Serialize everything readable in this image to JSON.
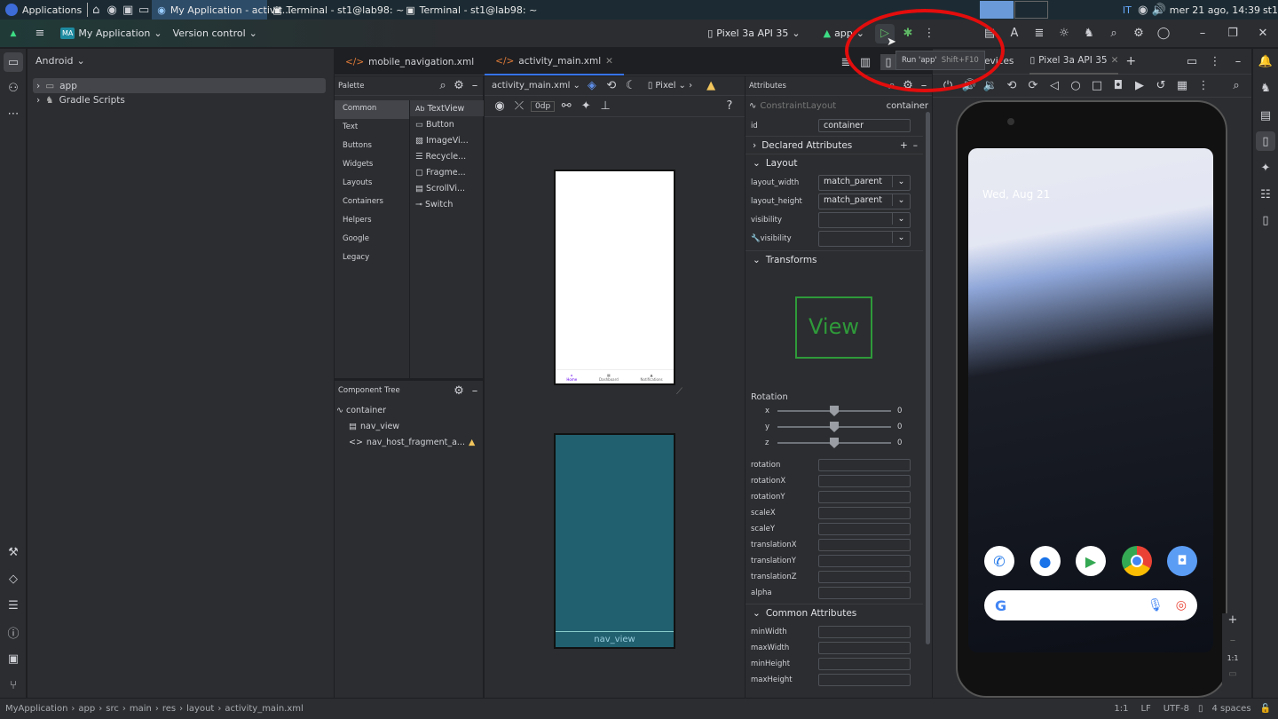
{
  "taskbar": {
    "apps_label": "Applications",
    "windows": [
      {
        "title": "My Application - activit...",
        "active": true
      },
      {
        "title": "Terminal - st1@lab98: ~"
      },
      {
        "title": "Terminal - st1@lab98: ~"
      }
    ],
    "keyboard": "IT",
    "clock": "mer 21 ago, 14:39",
    "user": "st1"
  },
  "toolbar": {
    "project_badge": "MA",
    "project": "My Application",
    "vcs": "Version control",
    "device": "Pixel 3a API 35",
    "run_config": "app",
    "tooltip": "Run 'app'",
    "tooltip_shortcut": "Shift+F10",
    "accent": "#3574f0"
  },
  "project": {
    "view": "Android",
    "items": [
      {
        "label": "app"
      },
      {
        "label": "Gradle Scripts"
      }
    ]
  },
  "editor": {
    "tabs": [
      {
        "label": "mobile_navigation.xml"
      },
      {
        "label": "activity_main.xml",
        "selected": true
      }
    ],
    "file_select": "activity_main.xml",
    "device_select": "Pixel",
    "margin": "0dp"
  },
  "palette": {
    "title": "Palette",
    "categories": [
      "Common",
      "Text",
      "Buttons",
      "Widgets",
      "Layouts",
      "Containers",
      "Helpers",
      "Google",
      "Legacy"
    ],
    "selected": "Common",
    "widgets": [
      "TextView",
      "Button",
      "ImageVi...",
      "Recycle...",
      "Fragme...",
      "ScrollVi...",
      "Switch"
    ]
  },
  "tree": {
    "title": "Component Tree",
    "items": [
      "container",
      "nav_view",
      "nav_host_fragment_a..."
    ]
  },
  "preview": {
    "nav": [
      "Home",
      "Dashboard",
      "Notifications"
    ],
    "blueprint_label": "nav_view"
  },
  "attributes": {
    "title": "Attributes",
    "class": "ConstraintLayout",
    "id_label": "id",
    "id_value": "container",
    "sections": {
      "declared": "Declared Attributes",
      "layout": "Layout",
      "transforms": "Transforms",
      "common": "Common Attributes"
    },
    "layout": [
      {
        "name": "layout_width",
        "value": "match_parent"
      },
      {
        "name": "layout_height",
        "value": "match_parent"
      },
      {
        "name": "visibility",
        "value": ""
      },
      {
        "name": "visibility",
        "value": ""
      }
    ],
    "view_label": "View",
    "rotation_label": "Rotation",
    "rotation_axes": [
      {
        "axis": "x",
        "value": "0"
      },
      {
        "axis": "y",
        "value": "0"
      },
      {
        "axis": "z",
        "value": "0"
      }
    ],
    "transform_fields": [
      "rotation",
      "rotationX",
      "rotationY",
      "scaleX",
      "scaleY",
      "translationX",
      "translationY",
      "translationZ",
      "alpha"
    ],
    "common_fields": [
      "minWidth",
      "maxWidth",
      "minHeight",
      "maxHeight"
    ]
  },
  "devices": {
    "title": "Devices",
    "tab": "Pixel 3a API 35",
    "date": "Wed, Aug 21",
    "zoom_label": "1:1"
  },
  "status": {
    "path": [
      "MyApplication",
      "app",
      "src",
      "main",
      "res",
      "layout",
      "activity_main.xml"
    ],
    "position": "1:1",
    "line_sep": "LF",
    "encoding": "UTF-8",
    "indent": "4 spaces"
  }
}
